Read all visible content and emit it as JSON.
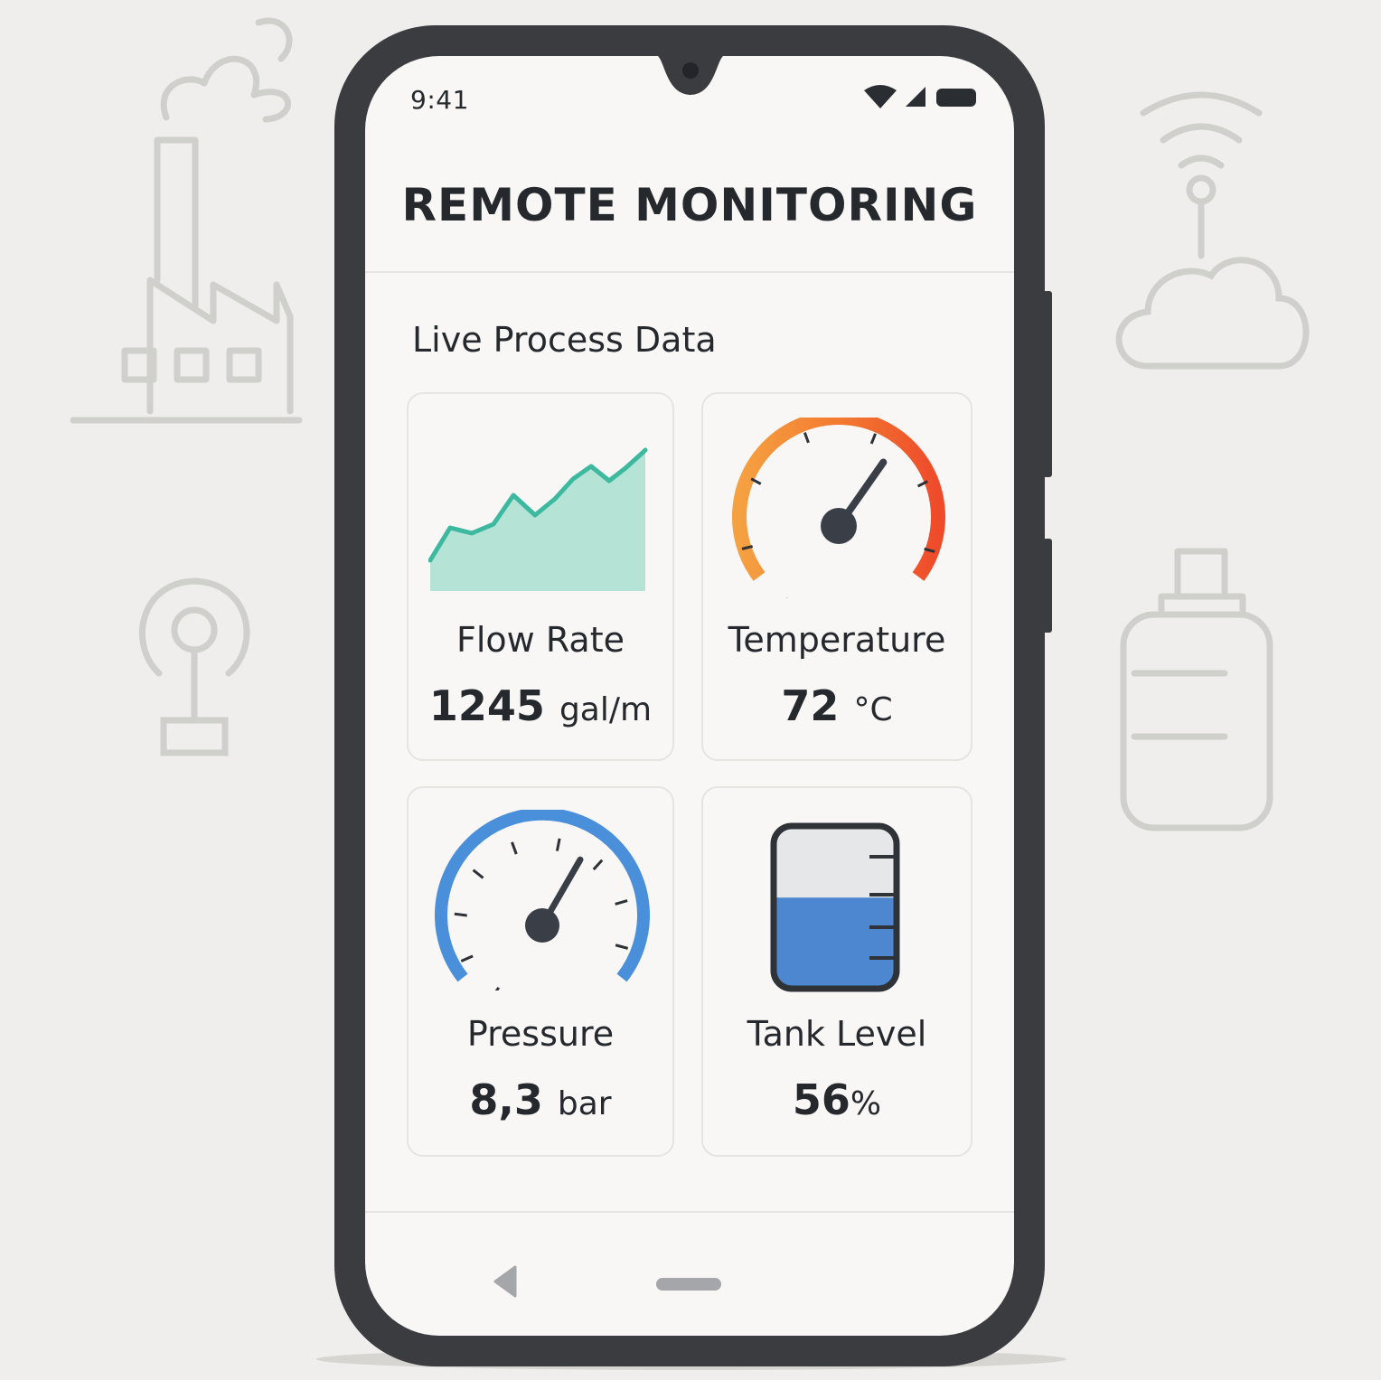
{
  "status_bar": {
    "time": "9:41"
  },
  "app": {
    "title": "REMOTE MONITORING"
  },
  "section": {
    "title": "Live Process Data"
  },
  "metrics": {
    "flow": {
      "label": "Flow Rate",
      "value": "1245",
      "unit": "gal/m"
    },
    "temperature": {
      "label": "Temperature",
      "value": "72",
      "unit": "°C",
      "gauge_level": 0.72
    },
    "pressure": {
      "label": "Pressure",
      "value": "8,3",
      "unit": "bar",
      "gauge_level": 0.7
    },
    "tank": {
      "label": "Tank Level",
      "value": "56",
      "unit": "%",
      "fill_level": 0.56
    }
  },
  "colors": {
    "flow_fill": "#b5e3d6",
    "flow_line": "#3cb99e",
    "temp_low": "#f5a142",
    "temp_high": "#ee4b2b",
    "pressure_blue": "#4a8fd9",
    "tank_blue": "#4d87cf",
    "text_dark": "#25282d"
  },
  "background_icons": [
    "factory-icon",
    "wifi-cloud-icon",
    "antenna-icon",
    "tank-icon"
  ],
  "nav": {
    "icons": [
      "back-icon",
      "home-bar-icon"
    ]
  }
}
